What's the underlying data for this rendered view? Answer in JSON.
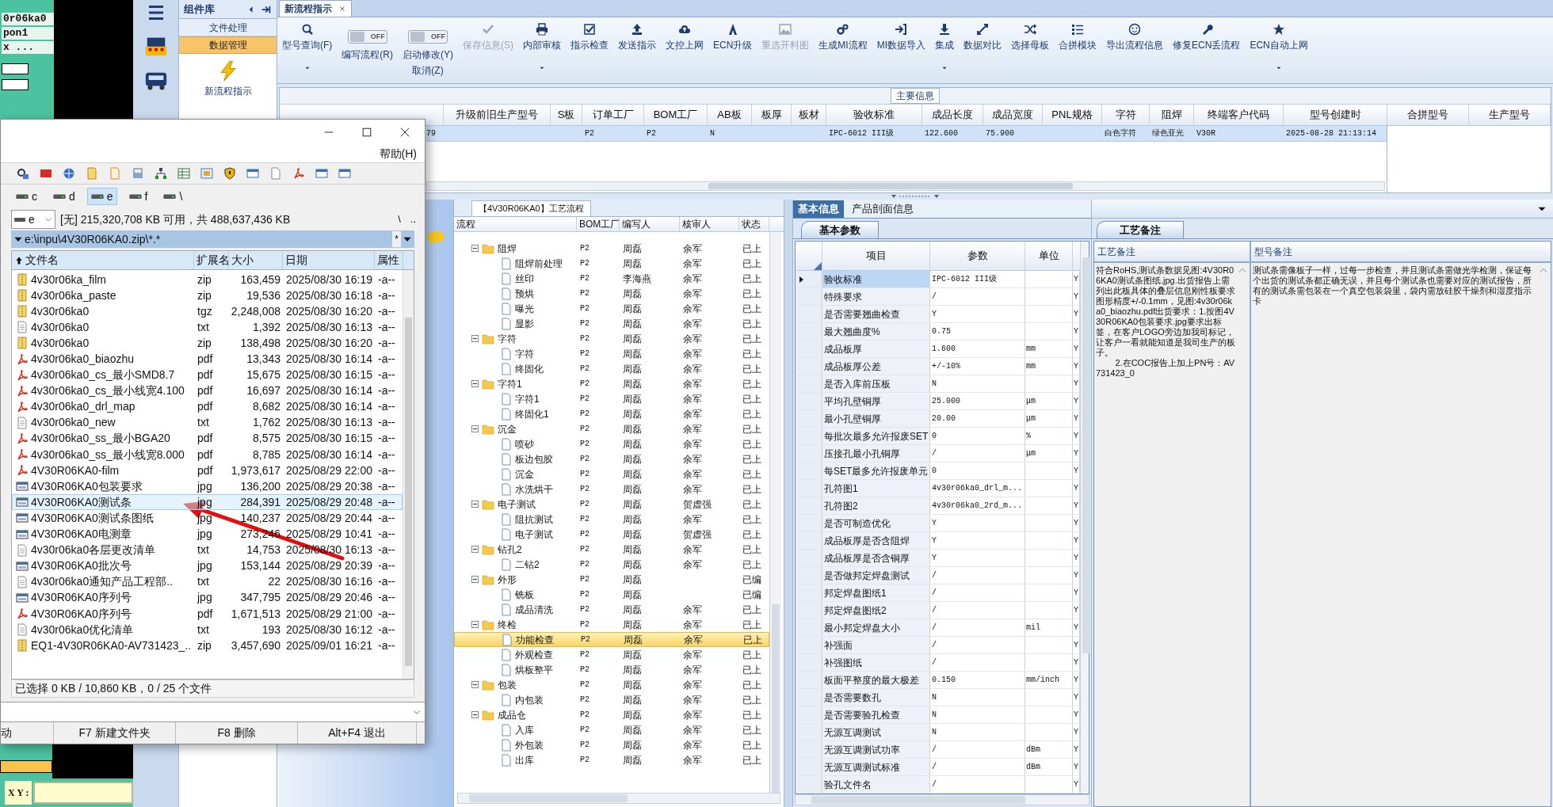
{
  "cad_panel": {
    "lines": [
      "0r06ka0",
      "pon1",
      "x ..."
    ],
    "xy_label": "X Y :"
  },
  "component_panel": {
    "title": "组件库",
    "items": [
      {
        "label": "文件处理",
        "selected": false
      },
      {
        "label": "数据管理",
        "selected": true
      }
    ],
    "shortcut": "新流程指示"
  },
  "document_tabs": [
    {
      "label": "新流程指示",
      "selected": true
    }
  ],
  "toolbar": {
    "items": [
      {
        "kind": "button",
        "label": "型号查询(F)",
        "disabled": false,
        "dropdown": true
      },
      {
        "kind": "toggle",
        "toggle_text": "OFF",
        "on": false,
        "label": "编写流程(R)"
      },
      {
        "kind": "toggle",
        "toggle_text": "OFF",
        "on": false,
        "label": "启动修改(Y)",
        "label_2": "取消(Z)"
      },
      {
        "kind": "button",
        "label": "保存信息(S)",
        "disabled": true,
        "dropdown": false
      },
      {
        "kind": "button",
        "label": "内部审核",
        "disabled": false,
        "dropdown": true
      },
      {
        "kind": "button",
        "label": "指示检查",
        "disabled": false,
        "dropdown": false
      },
      {
        "kind": "button",
        "label": "发送指示",
        "disabled": false,
        "dropdown": false
      },
      {
        "kind": "button",
        "label": "文控上网",
        "disabled": false,
        "dropdown": false
      },
      {
        "kind": "button",
        "label": "ECN升级",
        "disabled": false,
        "dropdown": false
      },
      {
        "kind": "button",
        "label": "重选开料图",
        "disabled": true,
        "dropdown": false
      },
      {
        "kind": "button",
        "label": "生成MI流程",
        "disabled": false,
        "dropdown": false
      },
      {
        "kind": "button",
        "label": "MI数据导入",
        "disabled": false,
        "dropdown": false
      },
      {
        "kind": "button",
        "label": "集成",
        "disabled": false,
        "dropdown": true
      },
      {
        "kind": "button",
        "label": "数据对比",
        "disabled": false,
        "dropdown": false
      },
      {
        "kind": "button",
        "label": "选择母板",
        "disabled": false,
        "dropdown": false
      },
      {
        "kind": "button",
        "label": "合拼模块",
        "disabled": false,
        "dropdown": false
      },
      {
        "kind": "button",
        "label": "导出流程信息",
        "disabled": false,
        "dropdown": false
      },
      {
        "kind": "button",
        "label": "修复ECN丢流程",
        "disabled": false,
        "dropdown": false
      },
      {
        "kind": "button",
        "label": "ECN自动上网",
        "disabled": false,
        "dropdown": true
      }
    ]
  },
  "main_info": {
    "title": "主要信息",
    "partial_cell": "79",
    "columns": [
      "升级前旧生产型号",
      "S板",
      "订单工厂",
      "BOM工厂",
      "AB板",
      "板厚",
      "板材",
      "验收标准",
      "成品长度",
      "成品宽度",
      "PNL规格",
      "字符",
      "阻焊",
      "终端客户代码",
      "型号创建时"
    ],
    "rows": [
      {
        "selected": true,
        "cells": [
          null,
          null,
          "P2",
          "P2",
          "N",
          null,
          null,
          "IPC-6012 III级",
          "122.600",
          "75.900",
          null,
          "白色字符",
          "绿色亚光",
          "V30R",
          "2025-08-28 21:13:14"
        ]
      }
    ],
    "side_columns": [
      "合拼型号",
      "生产型号"
    ]
  },
  "process_tree": {
    "tab": "【4V30R06KA0】工艺流程",
    "columns": [
      "流程",
      "BOM工厂",
      "编写人",
      "核审人",
      "状态"
    ],
    "nodes": [
      {
        "name": "阻焊",
        "bom": "P2",
        "writer": "周磊",
        "reviewer": "余军",
        "status": "已上",
        "expanded": true,
        "selected": false,
        "children": [
          {
            "name": "阻焊前处理",
            "bom": "P2",
            "writer": "周磊",
            "reviewer": "余军",
            "status": "已上",
            "selected": false
          },
          {
            "name": "丝印",
            "bom": "P2",
            "writer": "李海燕",
            "reviewer": "余军",
            "status": "已上",
            "selected": false
          },
          {
            "name": "预烘",
            "bom": "P2",
            "writer": "周磊",
            "reviewer": "余军",
            "status": "已上",
            "selected": false
          },
          {
            "name": "曝光",
            "bom": "P2",
            "writer": "周磊",
            "reviewer": "余军",
            "status": "已上",
            "selected": false
          },
          {
            "name": "显影",
            "bom": "P2",
            "writer": "周磊",
            "reviewer": "余军",
            "status": "已上",
            "selected": false
          }
        ]
      },
      {
        "name": "字符",
        "bom": "P2",
        "writer": "周磊",
        "reviewer": "余军",
        "status": "已上",
        "expanded": true,
        "selected": false,
        "children": [
          {
            "name": "字符",
            "bom": "P2",
            "writer": "周磊",
            "reviewer": "余军",
            "status": "已上",
            "selected": false
          },
          {
            "name": "终固化",
            "bom": "P2",
            "writer": "周磊",
            "reviewer": "余军",
            "status": "已上",
            "selected": false
          }
        ]
      },
      {
        "name": "字符1",
        "bom": "P2",
        "writer": "周磊",
        "reviewer": "余军",
        "status": "已上",
        "expanded": true,
        "selected": false,
        "children": [
          {
            "name": "字符1",
            "bom": "P2",
            "writer": "周磊",
            "reviewer": "余军",
            "status": "已上",
            "selected": false
          },
          {
            "name": "终固化1",
            "bom": "P2",
            "writer": "周磊",
            "reviewer": "余军",
            "status": "已上",
            "selected": false
          }
        ]
      },
      {
        "name": "沉金",
        "bom": "P2",
        "writer": "周磊",
        "reviewer": "余军",
        "status": "已上",
        "expanded": true,
        "selected": false,
        "children": [
          {
            "name": "喷砂",
            "bom": "P2",
            "writer": "周磊",
            "reviewer": "余军",
            "status": "已上",
            "selected": false
          },
          {
            "name": "板边包胶",
            "bom": "P2",
            "writer": "周磊",
            "reviewer": "余军",
            "status": "已上",
            "selected": false
          },
          {
            "name": "沉金",
            "bom": "P2",
            "writer": "周磊",
            "reviewer": "余军",
            "status": "已上",
            "selected": false
          },
          {
            "name": "水洗烘干",
            "bom": "P2",
            "writer": "周磊",
            "reviewer": "余军",
            "status": "已上",
            "selected": false
          }
        ]
      },
      {
        "name": "电子测试",
        "bom": "P2",
        "writer": "周磊",
        "reviewer": "贺虚强",
        "status": "已上",
        "expanded": true,
        "selected": false,
        "children": [
          {
            "name": "阻抗测试",
            "bom": "P2",
            "writer": "周磊",
            "reviewer": "余军",
            "status": "已上",
            "selected": false
          },
          {
            "name": "电子测试",
            "bom": "P2",
            "writer": "周磊",
            "reviewer": "贺虚强",
            "status": "已上",
            "selected": false
          }
        ]
      },
      {
        "name": "钻孔2",
        "bom": "P2",
        "writer": "周磊",
        "reviewer": "余军",
        "status": "已上",
        "expanded": true,
        "selected": false,
        "children": [
          {
            "name": "二钻2",
            "bom": "P2",
            "writer": "周磊",
            "reviewer": "余军",
            "status": "已上",
            "selected": false
          }
        ]
      },
      {
        "name": "外形",
        "bom": "P2",
        "writer": "周磊",
        "status": "已编",
        "expanded": true,
        "selected": false,
        "children": [
          {
            "name": "铣板",
            "bom": "P2",
            "writer": "周磊",
            "status": "已编",
            "selected": false
          },
          {
            "name": "成品清洗",
            "bom": "P2",
            "writer": "周磊",
            "reviewer": "余军",
            "status": "已上",
            "selected": false
          }
        ]
      },
      {
        "name": "终检",
        "bom": "P2",
        "writer": "周磊",
        "reviewer": "余军",
        "status": "已上",
        "expanded": true,
        "selected": false,
        "children": [
          {
            "name": "功能检查",
            "bom": "P2",
            "writer": "周磊",
            "reviewer": "余军",
            "status": "已上",
            "selected": true
          },
          {
            "name": "外观检查",
            "bom": "P2",
            "writer": "周磊",
            "reviewer": "余军",
            "status": "已上",
            "selected": false
          },
          {
            "name": "烘板整平",
            "bom": "P2",
            "writer": "周磊",
            "reviewer": "余军",
            "status": "已上",
            "selected": false
          }
        ]
      },
      {
        "name": "包装",
        "bom": "P2",
        "writer": "周磊",
        "reviewer": "余军",
        "status": "已上",
        "expanded": true,
        "selected": false,
        "children": [
          {
            "name": "内包装",
            "bom": "P2",
            "writer": "周磊",
            "reviewer": "余军",
            "status": "已上",
            "selected": false
          }
        ]
      },
      {
        "name": "成品仓",
        "bom": "P2",
        "writer": "周磊",
        "reviewer": "余军",
        "status": "已上",
        "expanded": true,
        "selected": false,
        "children": [
          {
            "name": "入库",
            "bom": "P2",
            "writer": "周磊",
            "reviewer": "余军",
            "status": "已上",
            "selected": false
          },
          {
            "name": "外包装",
            "bom": "P2",
            "writer": "周磊",
            "reviewer": "余军",
            "status": "已上",
            "selected": false
          },
          {
            "name": "出库",
            "bom": "P2",
            "writer": "周磊",
            "reviewer": "余军",
            "status": "已上",
            "selected": false
          }
        ]
      }
    ]
  },
  "parameters": {
    "tabs": [
      {
        "label": "基本信息",
        "selected": true
      },
      {
        "label": "产品剖面信息",
        "selected": false
      }
    ],
    "subtab": "基本参数",
    "columns": [
      "项目",
      "参数",
      "单位"
    ],
    "rows": [
      {
        "item": "验收标准",
        "value": "IPC-6012 III级",
        "flag": "Y",
        "selected": true
      },
      {
        "item": "特殊要求",
        "value": "/",
        "flag": "Y",
        "selected": false
      },
      {
        "item": "是否需要翘曲检查",
        "value": "Y",
        "flag": "Y",
        "selected": false
      },
      {
        "item": "最大翘曲度%",
        "value": "0.75",
        "flag": "Y",
        "selected": false
      },
      {
        "item": "成品板厚",
        "value": "1.600",
        "unit": "mm",
        "flag": "Y",
        "selected": false
      },
      {
        "item": "成品板厚公差",
        "value": "+/-10%",
        "unit": "mm",
        "flag": "Y",
        "selected": false
      },
      {
        "item": "是否入库前压板",
        "value": "N",
        "flag": "Y",
        "selected": false
      },
      {
        "item": "平均孔壁铜厚",
        "value": "25.000",
        "unit": "μm",
        "flag": "Y",
        "selected": false
      },
      {
        "item": "最小孔壁铜厚",
        "value": "20.00",
        "unit": "μm",
        "flag": "Y",
        "selected": false
      },
      {
        "item": "每批次最多允许报废SET",
        "value": "0",
        "unit": "%",
        "flag": "Y",
        "selected": false
      },
      {
        "item": "压接孔最小孔铜厚",
        "value": "/",
        "unit": "μm",
        "flag": "Y",
        "selected": false
      },
      {
        "item": "每SET最多允许报废单元",
        "value": "0",
        "flag": "Y",
        "selected": false
      },
      {
        "item": "孔符图1",
        "value": "4v30r06ka0_drl_m...",
        "flag": "Y",
        "selected": false
      },
      {
        "item": "孔符图2",
        "value": "4v30r06ka0_2rd_m...",
        "flag": "Y",
        "selected": false
      },
      {
        "item": "是否可制造优化",
        "value": "Y",
        "flag": "Y",
        "selected": false
      },
      {
        "item": "成品板厚是否含阻焊",
        "value": "Y",
        "flag": "Y",
        "selected": false
      },
      {
        "item": "成品板厚是否含铜厚",
        "value": "Y",
        "flag": "Y",
        "selected": false
      },
      {
        "item": "是否做邦定焊盘测试",
        "value": "/",
        "flag": "Y",
        "selected": false
      },
      {
        "item": "邦定焊盘图纸1",
        "value": "/",
        "flag": "Y",
        "selected": false
      },
      {
        "item": "邦定焊盘图纸2",
        "value": "/",
        "flag": "Y",
        "selected": false
      },
      {
        "item": "最小邦定焊盘大小",
        "value": "/",
        "unit": "mil",
        "flag": "Y",
        "selected": false
      },
      {
        "item": "补强面",
        "value": "/",
        "flag": "Y",
        "selected": false
      },
      {
        "item": "补强图纸",
        "value": "/",
        "flag": "Y",
        "selected": false
      },
      {
        "item": "板面平整度的最大极差",
        "value": "0.150",
        "unit": "mm/inch",
        "flag": "Y",
        "selected": false
      },
      {
        "item": "是否需要数孔",
        "value": "N",
        "flag": "Y",
        "selected": false
      },
      {
        "item": "是否需要验孔检查",
        "value": "N",
        "flag": "Y",
        "selected": false
      },
      {
        "item": "无源互调测试",
        "value": "N",
        "flag": "Y",
        "selected": false
      },
      {
        "item": "无源互调测试功率",
        "value": "/",
        "unit": "dBm",
        "flag": "Y",
        "selected": false
      },
      {
        "item": "无源互调测试标准",
        "value": "/",
        "unit": "dBm",
        "flag": "Y",
        "selected": false
      },
      {
        "item": "验孔文件名",
        "value": "/",
        "flag": "Y",
        "selected": false
      }
    ]
  },
  "notes": {
    "tab": "工艺备注",
    "columns": [
      {
        "title": "工艺备注",
        "text": "符合RoHS,测试条数据见图:4V30R06KA0测试条图纸.jpg.出货报告上需列出此板具体的叠层信息刚性板要求图形精度+/-0.1mm，见图:4v30r06ka0_biaozhu.pdf出货要求：1.按图4V30R06KA0包装要求.jpg要求出标签，在客户LOGO旁边加我司标记，让客户一看就能知道是我司生产的板子。\n        2.在COC报告上加上PN号：AV731423_0"
      },
      {
        "title": "型号备注",
        "text": "测试条需像板子一样，过每一步检查，并且测试条需做光学检测，保证每个出货的测试条都正确无误，并且每个测试条也需要对应的测试报告，所有的测试条需包装在一个真空包装袋里，袋内需放硅胶干燥剂和湿度指示卡"
      }
    ]
  },
  "file_manager": {
    "menu": [
      "帮助(H)"
    ],
    "drives": [
      {
        "label": "c",
        "selected": false
      },
      {
        "label": "d",
        "selected": false
      },
      {
        "label": "e",
        "selected": true
      },
      {
        "label": "f",
        "selected": false
      },
      {
        "label": "\\",
        "selected": false
      }
    ],
    "drive_combo": "e",
    "disk_info": "[无] 215,320,708 KB 可用，共 488,637,436 KB",
    "nav": [
      "\\",
      ".."
    ],
    "path": "e:\\inpu\\4V30R06KA0.zip\\*.*",
    "filter": "*",
    "columns": [
      "文件名",
      "扩展名",
      "大小",
      "日期",
      "属性"
    ],
    "files": [
      {
        "kind": "archive",
        "name": "4v30r06ka_film",
        "ext": "zip",
        "size": "163,459",
        "date": "2025/08/30 16:19",
        "attr": "-a--",
        "selected": false
      },
      {
        "kind": "archive",
        "name": "4v30r06ka_paste",
        "ext": "zip",
        "size": "19,536",
        "date": "2025/08/30 16:18",
        "attr": "-a--",
        "selected": false
      },
      {
        "kind": "archive",
        "name": "4v30r06ka0",
        "ext": "tgz",
        "size": "2,248,008",
        "date": "2025/08/30 16:20",
        "attr": "-a--",
        "selected": false
      },
      {
        "kind": "text",
        "name": "4v30r06ka0",
        "ext": "txt",
        "size": "1,392",
        "date": "2025/08/30 16:13",
        "attr": "-a--",
        "selected": false
      },
      {
        "kind": "archive",
        "name": "4v30r06ka0",
        "ext": "zip",
        "size": "138,498",
        "date": "2025/08/30 16:20",
        "attr": "-a--",
        "selected": false
      },
      {
        "kind": "pdf",
        "name": "4v30r06ka0_biaozhu",
        "ext": "pdf",
        "size": "13,343",
        "date": "2025/08/30 16:14",
        "attr": "-a--",
        "selected": false
      },
      {
        "kind": "pdf",
        "name": "4v30r06ka0_cs_最小SMD8.7",
        "ext": "pdf",
        "size": "15,675",
        "date": "2025/08/30 16:15",
        "attr": "-a--",
        "selected": false
      },
      {
        "kind": "pdf",
        "name": "4v30r06ka0_cs_最小线宽4.100",
        "ext": "pdf",
        "size": "16,697",
        "date": "2025/08/30 16:14",
        "attr": "-a--",
        "selected": false
      },
      {
        "kind": "pdf",
        "name": "4v30r06ka0_drl_map",
        "ext": "pdf",
        "size": "8,682",
        "date": "2025/08/30 16:14",
        "attr": "-a--",
        "selected": false
      },
      {
        "kind": "text",
        "name": "4v30r06ka0_new",
        "ext": "txt",
        "size": "1,762",
        "date": "2025/08/30 16:13",
        "attr": "-a--",
        "selected": false
      },
      {
        "kind": "pdf",
        "name": "4v30r06ka0_ss_最小BGA20",
        "ext": "pdf",
        "size": "8,575",
        "date": "2025/08/30 16:15",
        "attr": "-a--",
        "selected": false
      },
      {
        "kind": "pdf",
        "name": "4v30r06ka0_ss_最小线宽8.000",
        "ext": "pdf",
        "size": "8,785",
        "date": "2025/08/30 16:14",
        "attr": "-a--",
        "selected": false
      },
      {
        "kind": "pdf",
        "name": "4V30R06KA0-film",
        "ext": "pdf",
        "size": "1,973,617",
        "date": "2025/08/29 22:00",
        "attr": "-a--",
        "selected": false
      },
      {
        "kind": "image",
        "name": "4V30R06KA0包装要求",
        "ext": "jpg",
        "size": "136,200",
        "date": "2025/08/29 20:38",
        "attr": "-a--",
        "selected": false
      },
      {
        "kind": "image",
        "name": "4V30R06KA0测试条",
        "ext": "jpg",
        "size": "284,391",
        "date": "2025/08/29 20:48",
        "attr": "-a--",
        "selected": true
      },
      {
        "kind": "image",
        "name": "4V30R06KA0测试条图纸",
        "ext": "jpg",
        "size": "140,237",
        "date": "2025/08/29 20:44",
        "attr": "-a--",
        "selected": false
      },
      {
        "kind": "image",
        "name": "4V30R06KA0电测章",
        "ext": "jpg",
        "size": "273,246",
        "date": "2025/08/29 10:41",
        "attr": "-a--",
        "selected": false
      },
      {
        "kind": "text",
        "name": "4v30r06ka0各层更改清单",
        "ext": "txt",
        "size": "14,753",
        "date": "2025/08/30 16:13",
        "attr": "-a--",
        "selected": false
      },
      {
        "kind": "image",
        "name": "4V30R06KA0批次号",
        "ext": "jpg",
        "size": "153,144",
        "date": "2025/08/29 20:39",
        "attr": "-a--",
        "selected": false
      },
      {
        "kind": "text",
        "name": "4v30r06ka0通知产品工程部..",
        "ext": "txt",
        "size": "22",
        "date": "2025/08/30 16:16",
        "attr": "-a--",
        "selected": false
      },
      {
        "kind": "image",
        "name": "4V30R06KA0序列号",
        "ext": "jpg",
        "size": "347,795",
        "date": "2025/08/29 20:46",
        "attr": "-a--",
        "selected": false
      },
      {
        "kind": "pdf",
        "name": "4V30R06KA0序列号",
        "ext": "pdf",
        "size": "1,671,513",
        "date": "2025/08/29 21:00",
        "attr": "-a--",
        "selected": false
      },
      {
        "kind": "text",
        "name": "4v30r06ka0优化清单",
        "ext": "txt",
        "size": "193",
        "date": "2025/08/30 16:12",
        "attr": "-a--",
        "selected": false
      },
      {
        "kind": "archive",
        "name": "EQ1-4V30R06KA0-AV731423_..",
        "ext": "zip",
        "size": "3,457,690",
        "date": "2025/09/01 16:21",
        "attr": "-a--",
        "selected": false
      }
    ],
    "status": "已选择 0 KB / 10,860 KB，0 / 25 个文件",
    "function_keys": [
      "动",
      "F7 新建文件夹",
      "F8 删除",
      "Alt+F4 退出"
    ]
  }
}
